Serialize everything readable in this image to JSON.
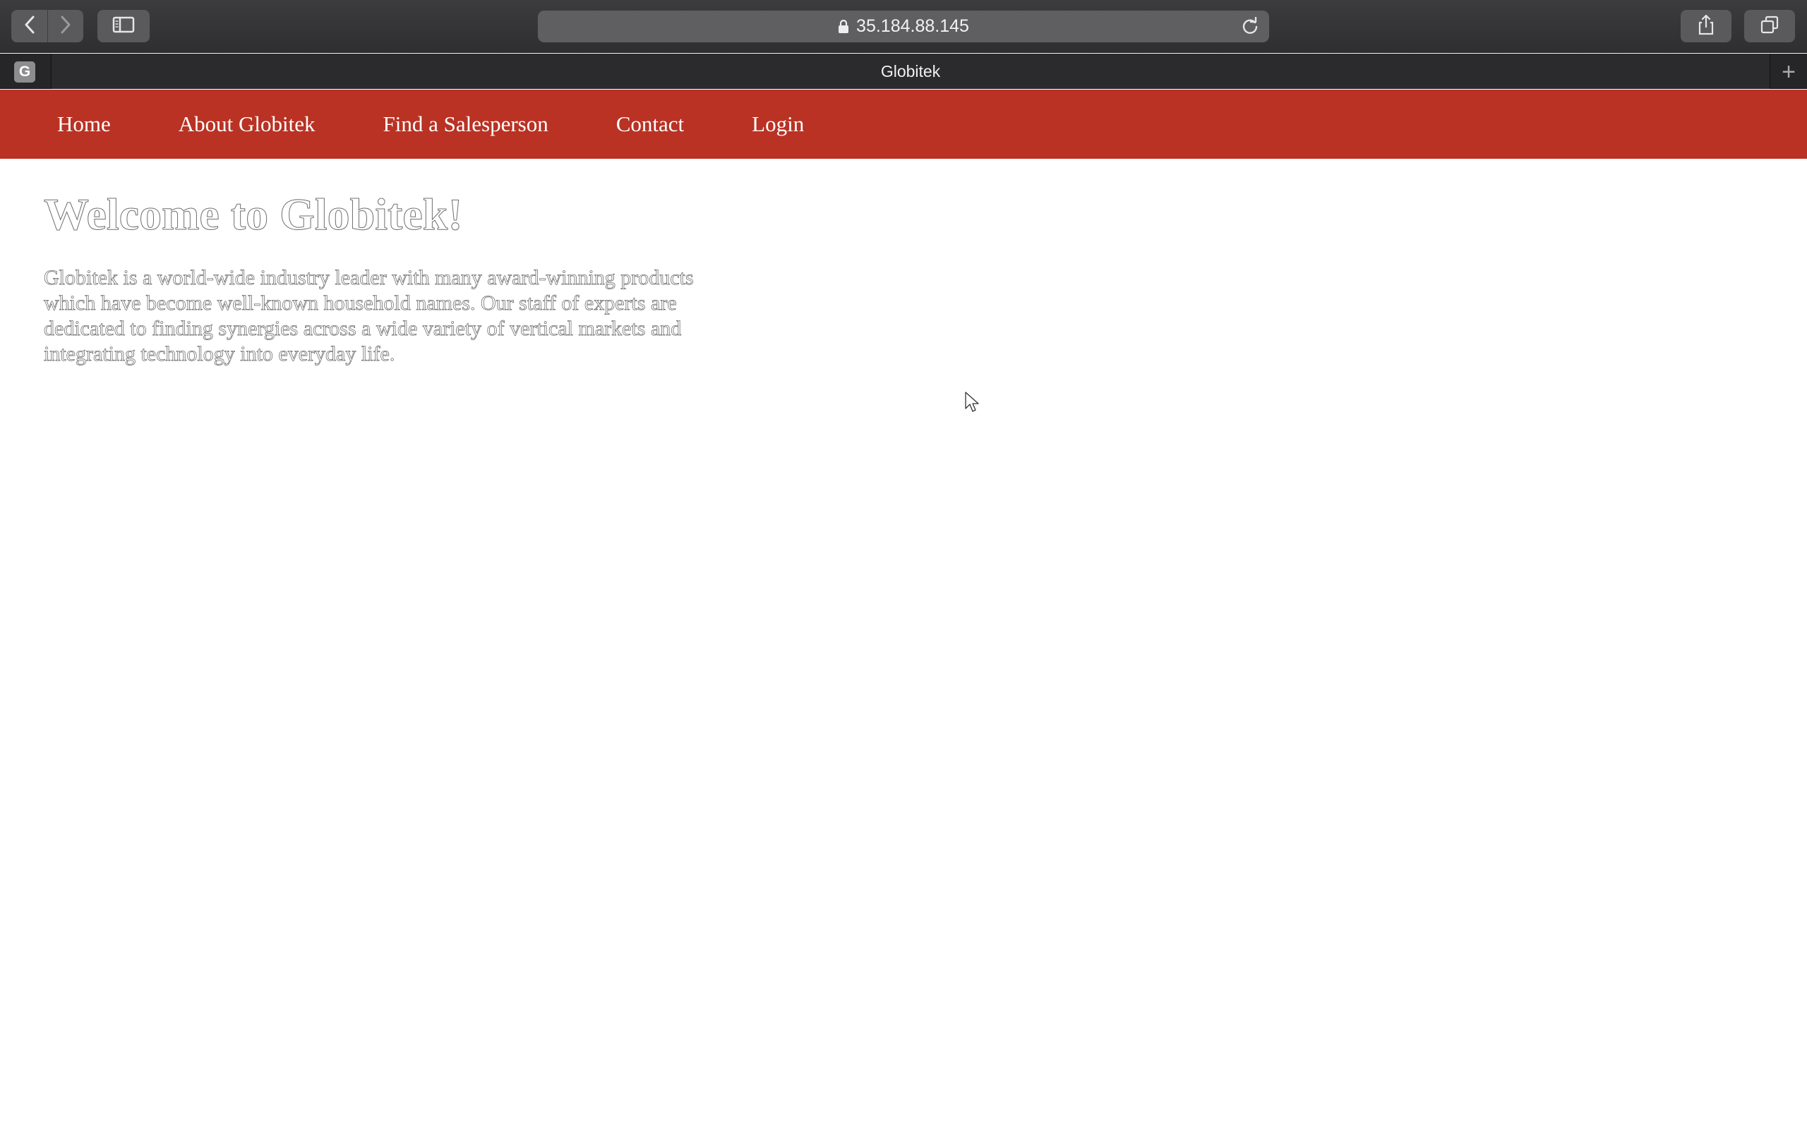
{
  "browser": {
    "url": "35.184.88.145",
    "tab_title": "Globitek",
    "favicon_letter": "G",
    "icons": [
      "back-icon",
      "forward-icon",
      "sidebar-icon",
      "lock-icon",
      "reload-icon",
      "share-icon",
      "tabs-overview-icon",
      "new-tab-icon"
    ]
  },
  "nav": {
    "items": [
      {
        "label": "Home"
      },
      {
        "label": "About Globitek"
      },
      {
        "label": "Find a Salesperson"
      },
      {
        "label": "Contact"
      },
      {
        "label": "Login"
      }
    ]
  },
  "main": {
    "heading": "Welcome to Globitek!",
    "intro": "Globitek is a world-wide industry leader with many award-winning products which have become well-known household names. Our staff of experts are dedicated to finding synergies across a wide variety of vertical markets and integrating technology into everyday life."
  },
  "colors": {
    "nav_background": "#b93224",
    "browser_chrome": "#2f2e30"
  }
}
